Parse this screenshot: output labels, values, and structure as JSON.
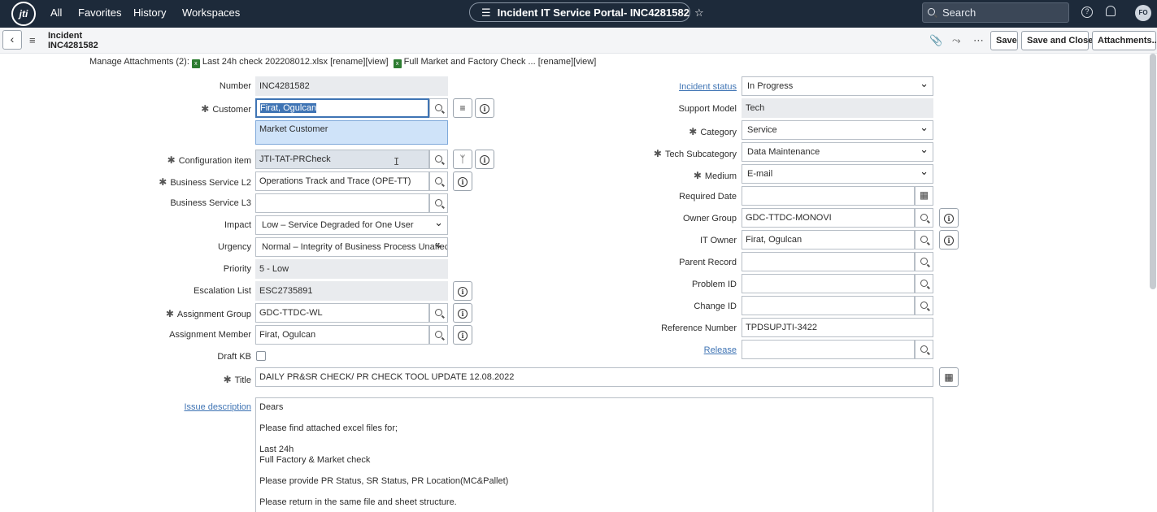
{
  "topnav": {
    "logo_text": "jti",
    "links": [
      "All",
      "Favorites",
      "History",
      "Workspaces"
    ],
    "page_title": "Incident IT Service Portal- INC4281582",
    "search_placeholder": "Search",
    "avatar_initials": "FO"
  },
  "header": {
    "record_type": "Incident",
    "record_number": "INC4281582",
    "buttons": {
      "save": "Save",
      "save_close": "Save and Close",
      "attachments": "Attachments..."
    }
  },
  "attachments": {
    "prefix": "Manage Attachments (2):",
    "file1": "Last 24h check 202208012.xlsx [rename][view]",
    "file2": "Full Market and Factory Check ... [rename][view]"
  },
  "left": {
    "number": {
      "label": "Number",
      "value": "INC4281582"
    },
    "customer": {
      "label": "Customer",
      "value": "Firat, Ogulcan",
      "tag": "Market Customer"
    },
    "config_item": {
      "label": "Configuration item",
      "value": "JTI-TAT-PRCheck"
    },
    "bs_l2": {
      "label": "Business Service L2",
      "value": "Operations Track and Trace (OPE-TT)"
    },
    "bs_l3": {
      "label": "Business Service L3",
      "value": ""
    },
    "impact": {
      "label": "Impact",
      "value": "Low – Service Degraded for One User"
    },
    "urgency": {
      "label": "Urgency",
      "value": "Normal – Integrity of Business Process Unaffec"
    },
    "priority": {
      "label": "Priority",
      "value": "5 - Low"
    },
    "escalation": {
      "label": "Escalation List",
      "value": "ESC2735891"
    },
    "assign_group": {
      "label": "Assignment Group",
      "value": "GDC-TTDC-WL"
    },
    "assign_member": {
      "label": "Assignment Member",
      "value": "Firat, Ogulcan"
    },
    "draft_kb": {
      "label": "Draft KB",
      "checked": false
    }
  },
  "right": {
    "incident_status": {
      "label": "Incident status",
      "value": "In Progress"
    },
    "support_model": {
      "label": "Support Model",
      "value": "Tech"
    },
    "category": {
      "label": "Category",
      "value": "Service"
    },
    "tech_subcategory": {
      "label": "Tech Subcategory",
      "value": "Data Maintenance"
    },
    "medium": {
      "label": "Medium",
      "value": "E-mail"
    },
    "required_date": {
      "label": "Required Date",
      "value": ""
    },
    "owner_group": {
      "label": "Owner Group",
      "value": "GDC-TTDC-MONOVI"
    },
    "it_owner": {
      "label": "IT Owner",
      "value": "Firat, Ogulcan"
    },
    "parent_record": {
      "label": "Parent Record",
      "value": ""
    },
    "problem_id": {
      "label": "Problem ID",
      "value": ""
    },
    "change_id": {
      "label": "Change ID",
      "value": ""
    },
    "reference_number": {
      "label": "Reference Number",
      "value": "TPDSUPJTI-3422"
    },
    "release": {
      "label": "Release",
      "value": ""
    }
  },
  "title": {
    "label": "Title",
    "value": "DAILY PR&SR CHECK/ PR CHECK TOOL UPDATE 12.08.2022"
  },
  "issue": {
    "label": "Issue description",
    "lines": [
      "Dears",
      "",
      "Please find attached excel files for;",
      "",
      "Last 24h",
      "Full Factory & Market check",
      "",
      "Please provide PR Status, SR Status, PR Location(MC&Pallet)",
      "",
      "Please return in the same file and sheet structure."
    ]
  }
}
